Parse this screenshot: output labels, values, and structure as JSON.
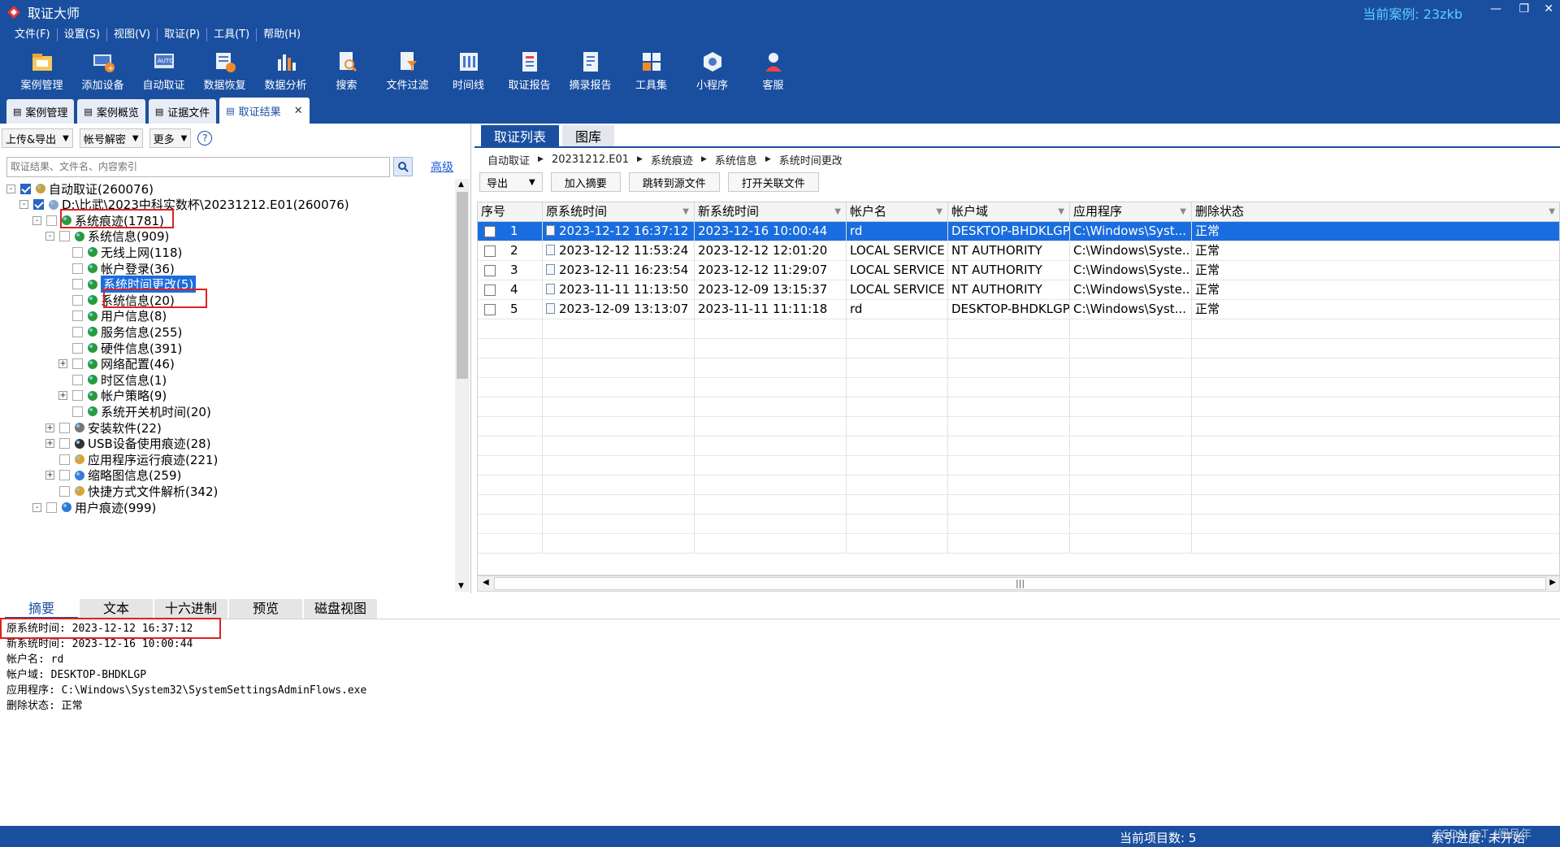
{
  "app": {
    "title": "取证大师",
    "current_case": "当前案例: 23zkb"
  },
  "menu": [
    "文件(F)",
    "设置(S)",
    "视图(V)",
    "取证(P)",
    "工具(T)",
    "帮助(H)"
  ],
  "toolbar": [
    {
      "label": "案例管理",
      "icon": "case-folder-icon"
    },
    {
      "label": "添加设备",
      "icon": "add-device-icon"
    },
    {
      "label": "自动取证",
      "icon": "auto-forensics-icon"
    },
    {
      "label": "数据恢复",
      "icon": "data-recovery-icon"
    },
    {
      "label": "数据分析",
      "icon": "analysis-icon"
    },
    {
      "label": "搜索",
      "icon": "search-icon"
    },
    {
      "label": "文件过滤",
      "icon": "file-filter-icon"
    },
    {
      "label": "时间线",
      "icon": "timeline-icon"
    },
    {
      "label": "取证报告",
      "icon": "report-icon"
    },
    {
      "label": "摘录报告",
      "icon": "excerpt-report-icon"
    },
    {
      "label": "工具集",
      "icon": "toolkit-icon"
    },
    {
      "label": "小程序",
      "icon": "miniapp-icon"
    },
    {
      "label": "客服",
      "icon": "support-icon"
    }
  ],
  "doc_tabs": [
    {
      "label": "案例管理"
    },
    {
      "label": "案例概览"
    },
    {
      "label": "证据文件"
    },
    {
      "label": "取证结果",
      "active": true
    }
  ],
  "left": {
    "tools": [
      "上传&导出",
      "帐号解密",
      "更多"
    ],
    "help": "?",
    "search_placeholder": "取证结果、文件名、内容索引",
    "advanced": "高级",
    "tree": [
      {
        "label": "自动取证(260076)",
        "level": 0,
        "exp": "-",
        "checked": true,
        "icon": "auto-icon"
      },
      {
        "label": "D:\\比武\\2023中科实数杯\\20231212.E01(260076)",
        "level": 1,
        "exp": "-",
        "checked": true,
        "icon": "disk-icon"
      },
      {
        "label": "系统痕迹(1781)",
        "level": 2,
        "exp": "-",
        "checked": false,
        "icon": "globe-icon"
      },
      {
        "label": "系统信息(909)",
        "level": 3,
        "exp": "-",
        "checked": false,
        "icon": "globe-icon"
      },
      {
        "label": "无线上网(118)",
        "level": 4,
        "exp": "",
        "checked": false,
        "icon": "globe-icon"
      },
      {
        "label": "帐户登录(36)",
        "level": 4,
        "exp": "",
        "checked": false,
        "icon": "globe-icon"
      },
      {
        "label": "系统时间更改(5)",
        "level": 4,
        "exp": "",
        "checked": false,
        "icon": "globe-icon",
        "selected": true
      },
      {
        "label": "系统信息(20)",
        "level": 4,
        "exp": "",
        "checked": false,
        "icon": "globe-icon"
      },
      {
        "label": "用户信息(8)",
        "level": 4,
        "exp": "",
        "checked": false,
        "icon": "globe-icon"
      },
      {
        "label": "服务信息(255)",
        "level": 4,
        "exp": "",
        "checked": false,
        "icon": "globe-icon"
      },
      {
        "label": "硬件信息(391)",
        "level": 4,
        "exp": "",
        "checked": false,
        "icon": "globe-icon"
      },
      {
        "label": "网络配置(46)",
        "level": 4,
        "exp": "+",
        "checked": false,
        "icon": "globe-icon"
      },
      {
        "label": "时区信息(1)",
        "level": 4,
        "exp": "",
        "checked": false,
        "icon": "globe-icon"
      },
      {
        "label": "帐户策略(9)",
        "level": 4,
        "exp": "+",
        "checked": false,
        "icon": "globe-icon"
      },
      {
        "label": "系统开关机时间(20)",
        "level": 4,
        "exp": "",
        "checked": false,
        "icon": "globe-icon"
      },
      {
        "label": "安装软件(22)",
        "level": 3,
        "exp": "+",
        "checked": false,
        "icon": "installer-icon"
      },
      {
        "label": "USB设备使用痕迹(28)",
        "level": 3,
        "exp": "+",
        "checked": false,
        "icon": "usb-icon"
      },
      {
        "label": "应用程序运行痕迹(221)",
        "level": 3,
        "exp": "",
        "checked": false,
        "icon": "app-icon"
      },
      {
        "label": "缩略图信息(259)",
        "level": 3,
        "exp": "+",
        "checked": false,
        "icon": "thumbnail-icon"
      },
      {
        "label": "快捷方式文件解析(342)",
        "level": 3,
        "exp": "",
        "checked": false,
        "icon": "shortcut-icon"
      },
      {
        "label": "用户痕迹(999)",
        "level": 2,
        "exp": "-",
        "checked": false,
        "icon": "user-globe-icon"
      }
    ]
  },
  "right": {
    "tabs": [
      {
        "label": "取证列表",
        "active": true
      },
      {
        "label": "图库"
      }
    ],
    "breadcrumb": [
      "自动取证",
      "20231212.E01",
      "系统痕迹",
      "系统信息",
      "系统时间更改"
    ],
    "tools": [
      "导出",
      "加入摘要",
      "跳转到源文件",
      "打开关联文件"
    ],
    "columns": [
      "序号",
      "原系统时间",
      "新系统时间",
      "帐户名",
      "帐户域",
      "应用程序",
      "删除状态"
    ],
    "rows": [
      [
        "1",
        "2023-12-12 16:37:12",
        "2023-12-16 10:00:44",
        "rd",
        "DESKTOP-BHDKLGP",
        "C:\\Windows\\Syst...",
        "正常"
      ],
      [
        "2",
        "2023-12-12 11:53:24",
        "2023-12-12 12:01:20",
        "LOCAL SERVICE",
        "NT AUTHORITY",
        "C:\\Windows\\Syste...",
        "正常"
      ],
      [
        "3",
        "2023-12-11 16:23:54",
        "2023-12-12 11:29:07",
        "LOCAL SERVICE",
        "NT AUTHORITY",
        "C:\\Windows\\Syste...",
        "正常"
      ],
      [
        "4",
        "2023-11-11 11:13:50",
        "2023-12-09 13:15:37",
        "LOCAL SERVICE",
        "NT AUTHORITY",
        "C:\\Windows\\Syste...",
        "正常"
      ],
      [
        "5",
        "2023-12-09 13:13:07",
        "2023-11-11 11:11:18",
        "rd",
        "DESKTOP-BHDKLGP",
        "C:\\Windows\\Syst...",
        "正常"
      ]
    ],
    "selected_row": 0,
    "hscroll_grip": "|||"
  },
  "bottom": {
    "tabs": [
      {
        "label": "摘要",
        "active": true
      },
      {
        "label": "文本"
      },
      {
        "label": "十六进制"
      },
      {
        "label": "预览"
      },
      {
        "label": "磁盘视图"
      }
    ],
    "detail": [
      "原系统时间: 2023-12-12 16:37:12",
      "新系统时间: 2023-12-16 10:00:44",
      "帐户名: rd",
      "帐户域: DESKTOP-BHDKLGP",
      "应用程序: C:\\Windows\\System32\\SystemSettingsAdminFlows.exe",
      "删除状态: 正常"
    ]
  },
  "status": {
    "count": "当前项目数: 5",
    "index": "索引进度: 未开始",
    "watermark": "CSDN @T_I阁月年"
  }
}
